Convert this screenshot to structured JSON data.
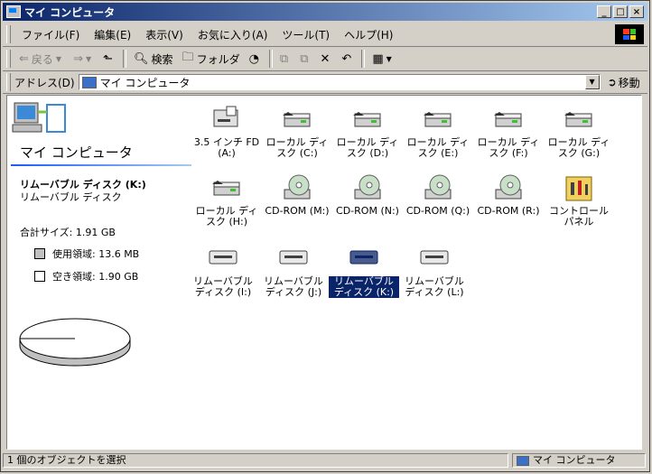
{
  "window": {
    "title": "マイ コンピュータ",
    "min_label": "_",
    "max_label": "□",
    "close_label": "×"
  },
  "menu": [
    "ファイル(F)",
    "編集(E)",
    "表示(V)",
    "お気に入り(A)",
    "ツール(T)",
    "ヘルプ(H)"
  ],
  "toolbar": {
    "back_label": "戻る",
    "search_label": "検索",
    "folders_label": "フォルダ"
  },
  "address": {
    "label": "アドレス(D)",
    "value": "マイ コンピュータ",
    "go_label": "移動"
  },
  "left_pane": {
    "title": "マイ コンピュータ",
    "selected_name": "リムーバブル ディスク (K:)",
    "selected_type": "リムーバブル ディスク",
    "total_size": "合計サイズ: 1.91 GB",
    "used": "使用領域: 13.6 MB",
    "free": "空き領域: 1.90 GB",
    "used_color": "#c0c0c0",
    "free_color": "#ffffff"
  },
  "items": [
    {
      "label": "3.5 インチ FD (A:)",
      "icon": "floppy-drive-icon"
    },
    {
      "label": "ローカル ディスク (C:)",
      "icon": "hard-disk-icon"
    },
    {
      "label": "ローカル ディスク (D:)",
      "icon": "hard-disk-icon"
    },
    {
      "label": "ローカル ディスク (E:)",
      "icon": "hard-disk-icon"
    },
    {
      "label": "ローカル ディスク (F:)",
      "icon": "hard-disk-icon"
    },
    {
      "label": "ローカル ディスク (G:)",
      "icon": "hard-disk-icon"
    },
    {
      "label": "ローカル ディスク (H:)",
      "icon": "hard-disk-icon"
    },
    {
      "label": "CD-ROM (M:)",
      "icon": "cdrom-icon"
    },
    {
      "label": "CD-ROM (N:)",
      "icon": "cdrom-icon"
    },
    {
      "label": "CD-ROM (Q:)",
      "icon": "cdrom-icon"
    },
    {
      "label": "CD-ROM (R:)",
      "icon": "cdrom-icon"
    },
    {
      "label": "コントロール パネル",
      "icon": "control-panel-icon"
    },
    {
      "label": "リムーバブル ディスク (I:)",
      "icon": "removable-disk-icon"
    },
    {
      "label": "リムーバブル ディスク (J:)",
      "icon": "removable-disk-icon"
    },
    {
      "label": "リムーバブル ディスク (K:)",
      "icon": "removable-disk-icon"
    },
    {
      "label": "リムーバブル ディスク (L:)",
      "icon": "removable-disk-icon"
    }
  ],
  "status": {
    "left": "1 個のオブジェクトを選択",
    "right": "マイ コンピュータ"
  }
}
